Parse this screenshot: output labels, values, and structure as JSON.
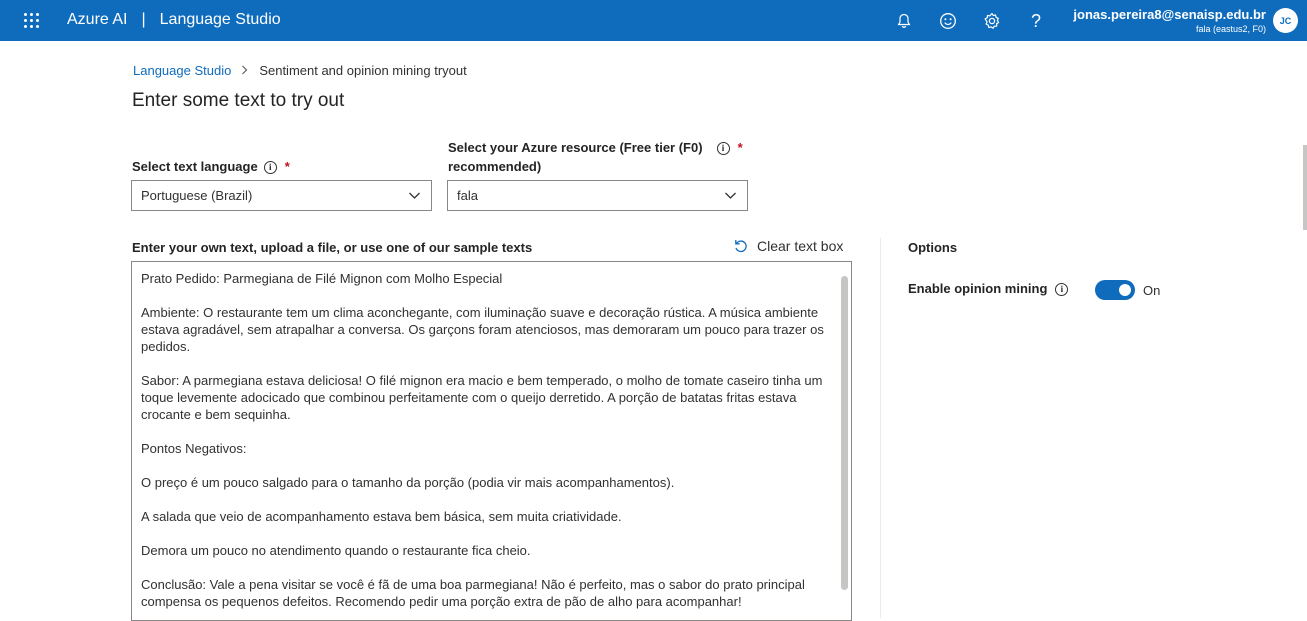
{
  "header": {
    "product": "Azure AI",
    "separator": "|",
    "app": "Language Studio",
    "icons": [
      "bell-icon",
      "smiley-icon",
      "gear-icon",
      "help-icon"
    ],
    "help_glyph": "?",
    "user_email": "jonas.pereira8@senaisp.edu.br",
    "user_resource": "fala (eastus2, F0)",
    "avatar_initials": "JC",
    "accent": "#0f6cbd"
  },
  "breadcrumb": {
    "root": "Language Studio",
    "chevron": ">",
    "current": "Sentiment and opinion mining tryout"
  },
  "page": {
    "title": "Enter some text to try out"
  },
  "form": {
    "language_label": "Select text language",
    "language_value": "Portuguese (Brazil)",
    "resource_label_line1": "Select your Azure resource (Free tier (F0)",
    "resource_label_line2": "recommended)",
    "resource_value": "fala",
    "required_mark": "*",
    "info_glyph": "i"
  },
  "input": {
    "label": "Enter your own text, upload a file, or use one of our sample texts",
    "clear_label": "Clear text box",
    "paragraphs": [
      "Prato Pedido: Parmegiana de Filé Mignon com Molho Especial",
      "Ambiente: O restaurante tem um clima aconchegante, com iluminação suave e decoração rústica. A música ambiente estava agradável, sem atrapalhar a conversa. Os garçons foram atenciosos, mas demoraram um pouco para trazer os pedidos.",
      "Sabor: A parmegiana estava deliciosa! O filé mignon era macio e bem temperado, o molho de tomate caseiro tinha um toque levemente adocicado que combinou perfeitamente com o queijo derretido. A porção de batatas fritas estava crocante e bem sequinha.",
      "Pontos Negativos:",
      "O preço é um pouco salgado para o tamanho da porção (podia vir mais acompanhamentos).",
      "A salada que veio de acompanhamento estava bem básica, sem muita criatividade.",
      "Demora um pouco no atendimento quando o restaurante fica cheio.",
      "Conclusão: Vale a pena visitar se você é fã de uma boa parmegiana! Não é perfeito, mas o sabor do prato principal compensa os pequenos defeitos. Recomendo pedir uma porção extra de pão de alho para acompanhar!"
    ]
  },
  "options": {
    "title": "Options",
    "opinion_mining_label": "Enable opinion mining",
    "opinion_mining_enabled": true,
    "toggle_state": "On"
  }
}
